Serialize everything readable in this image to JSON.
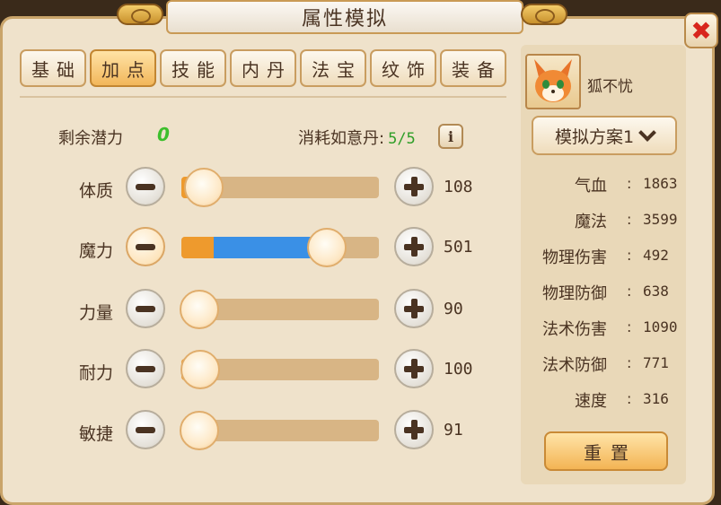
{
  "window": {
    "title": "属性模拟",
    "close_icon": "close-x-icon"
  },
  "tabs": [
    {
      "label": "基础",
      "active": false
    },
    {
      "label": "加点",
      "active": true
    },
    {
      "label": "技能",
      "active": false
    },
    {
      "label": "内丹",
      "active": false
    },
    {
      "label": "法宝",
      "active": false
    },
    {
      "label": "纹饰",
      "active": false
    },
    {
      "label": "装备",
      "active": false
    }
  ],
  "potential": {
    "label": "剩余潜力",
    "value": "0"
  },
  "consume": {
    "label": "消耗如意丹:",
    "value": "5/5",
    "info_icon": "info-icon"
  },
  "attributes": [
    {
      "name": "体质",
      "value": "108",
      "slider": 0.05,
      "allocated": 0.0
    },
    {
      "name": "魔力",
      "value": "501",
      "slider": 0.83,
      "allocated": 0.67
    },
    {
      "name": "力量",
      "value": "90",
      "slider": 0.02,
      "allocated": 0.0
    },
    {
      "name": "耐力",
      "value": "100",
      "slider": 0.03,
      "allocated": 0.0
    },
    {
      "name": "敏捷",
      "value": "91",
      "slider": 0.02,
      "allocated": 0.0
    }
  ],
  "pet": {
    "name": "狐不忧",
    "avatar_icon": "fox-avatar-icon"
  },
  "plan": {
    "label": "模拟方案1",
    "chevron_icon": "chevron-down-icon"
  },
  "stats": [
    {
      "label": "气血",
      "value": "1863"
    },
    {
      "label": "魔法",
      "value": "3599"
    },
    {
      "label": "物理伤害",
      "value": "492"
    },
    {
      "label": "物理防御",
      "value": "638"
    },
    {
      "label": "法术伤害",
      "value": "1090"
    },
    {
      "label": "法术防御",
      "value": "771"
    },
    {
      "label": "速度",
      "value": "316"
    }
  ],
  "reset_label": "重置",
  "colors": {
    "accent_orange": "#ee9a2d",
    "accent_blue": "#3a90e6",
    "potential_green": "#3dbf2c",
    "close_red": "#d8261c"
  }
}
